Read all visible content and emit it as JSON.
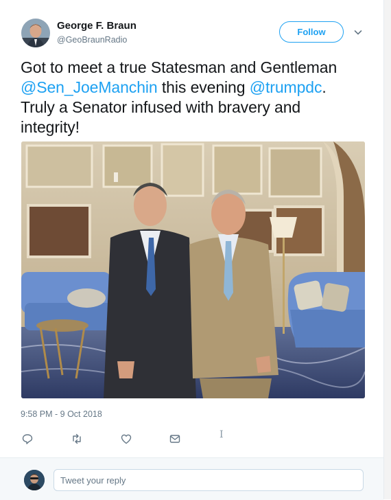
{
  "user": {
    "name": "George F. Braun",
    "handle": "@GeoBraunRadio"
  },
  "follow_label": "Follow",
  "tweet": {
    "text_part1": "Got to meet a true Statesman and Gentleman ",
    "mention1": "@Sen_JoeManchin",
    "text_part2": " this evening ",
    "mention2": "@trumpdc",
    "text_part3": ". Truly a Senator infused with bravery and integrity!",
    "timestamp": "9:58 PM - 9 Oct 2018"
  },
  "actions": {
    "reply_icon": "reply-icon",
    "retweet_icon": "retweet-icon",
    "like_icon": "heart-icon",
    "dm_icon": "envelope-icon"
  },
  "reply": {
    "placeholder": "Tweet your reply"
  },
  "colors": {
    "accent": "#1da1f2",
    "text": "#14171a",
    "secondary": "#657786"
  }
}
